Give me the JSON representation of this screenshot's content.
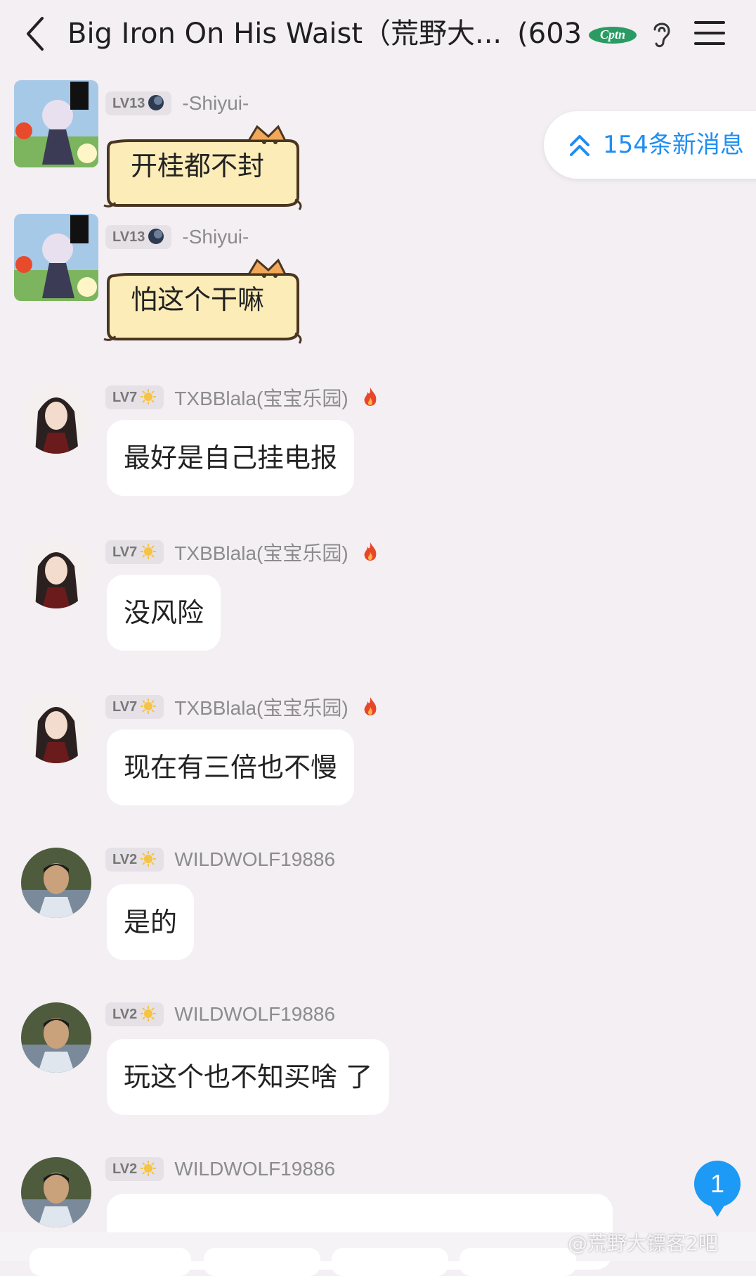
{
  "header": {
    "title": "Big Iron On His Waist（荒野大...",
    "member_count": "(603)",
    "badge_icon": "club-badge-icon",
    "back_icon": "chevron-left-icon",
    "ear_icon": "ear-icon",
    "menu_icon": "hamburger-menu-icon"
  },
  "new_messages": {
    "label": "154条新消息",
    "icon": "double-chevron-up-icon",
    "color": "#1f8ef2"
  },
  "messages": [
    {
      "level": "LV13",
      "level_icon": "moon-icon",
      "username": "-Shiyui-",
      "text": "开桂都不封",
      "bubble_style": "cat"
    },
    {
      "level": "LV13",
      "level_icon": "moon-icon",
      "username": "-Shiyui-",
      "text": "怕这个干嘛",
      "bubble_style": "cat"
    },
    {
      "level": "LV7",
      "level_icon": "sun-icon",
      "username": "TXBBlala(宝宝乐园)",
      "badge_icon": "fire-icon",
      "text": "最好是自己挂电报"
    },
    {
      "level": "LV7",
      "level_icon": "sun-icon",
      "username": "TXBBlala(宝宝乐园)",
      "badge_icon": "fire-icon",
      "text": "没风险"
    },
    {
      "level": "LV7",
      "level_icon": "sun-icon",
      "username": "TXBBlala(宝宝乐园)",
      "badge_icon": "fire-icon",
      "text": "现在有三倍也不慢"
    },
    {
      "level": "LV2",
      "level_icon": "sun-icon",
      "username": "WILDWOLF19886",
      "text": "是的"
    },
    {
      "level": "LV2",
      "level_icon": "sun-icon",
      "username": "WILDWOLF19886",
      "text": "玩这个也不知买啥 了"
    },
    {
      "level": "LV2",
      "level_icon": "sun-icon",
      "username": "WILDWOLF19886",
      "text": ""
    }
  ],
  "unread_badge": "1",
  "watermark": "@荒野大镖客2吧"
}
